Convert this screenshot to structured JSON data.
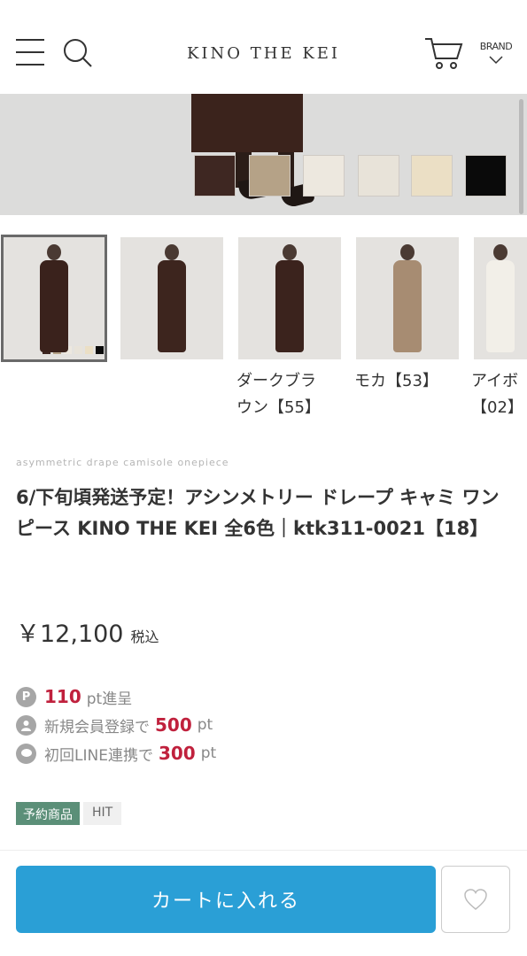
{
  "header": {
    "logo": "KINO THE KEI",
    "brand_label": "BRAND"
  },
  "hero": {
    "swatch_colors": [
      "#3e2722",
      "#b5a287",
      "#ede8df",
      "#e8e3d9",
      "#ebdfc5",
      "#0a0a0a"
    ]
  },
  "thumbnails": [
    {
      "caption": "",
      "dress_color": "#3a221c"
    },
    {
      "caption": "",
      "dress_color": "#3d251e"
    },
    {
      "caption": "ダークブラウン【55】",
      "dress_color": "#3b231d"
    },
    {
      "caption": "モカ【53】",
      "dress_color": "#a78c72"
    },
    {
      "caption": "アイボ【02】",
      "dress_color": "#f2efe8"
    }
  ],
  "captions": {
    "c3_line1": "ダークブラ",
    "c3_line2": "ウン【55】",
    "c4": "モカ【53】",
    "c5_line1": "アイボ",
    "c5_line2": "【02】"
  },
  "product": {
    "subtitle": "asymmetric drape camisole onepiece",
    "title": "6/下旬頃発送予定！アシンメトリー ドレープ キャミ ワンピース KINO THE KEI 全6色｜ktk311-0021【18】",
    "price": "￥12,100",
    "tax_label": "税込"
  },
  "points": {
    "p_icon": "P",
    "earn_value": "110",
    "earn_unit": "pt進呈",
    "signup_text": "新規会員登録で",
    "signup_value": "500",
    "signup_unit": "pt",
    "line_text": "初回LINE連携で",
    "line_value": "300",
    "line_unit": "pt"
  },
  "tags": [
    "予約商品",
    "HIT"
  ],
  "actions": {
    "cart_label": "カートに入れる"
  },
  "colors": {
    "accent_blue": "#2a9fd6",
    "point_red": "#c0213d",
    "tag_green": "#5b8f78"
  }
}
